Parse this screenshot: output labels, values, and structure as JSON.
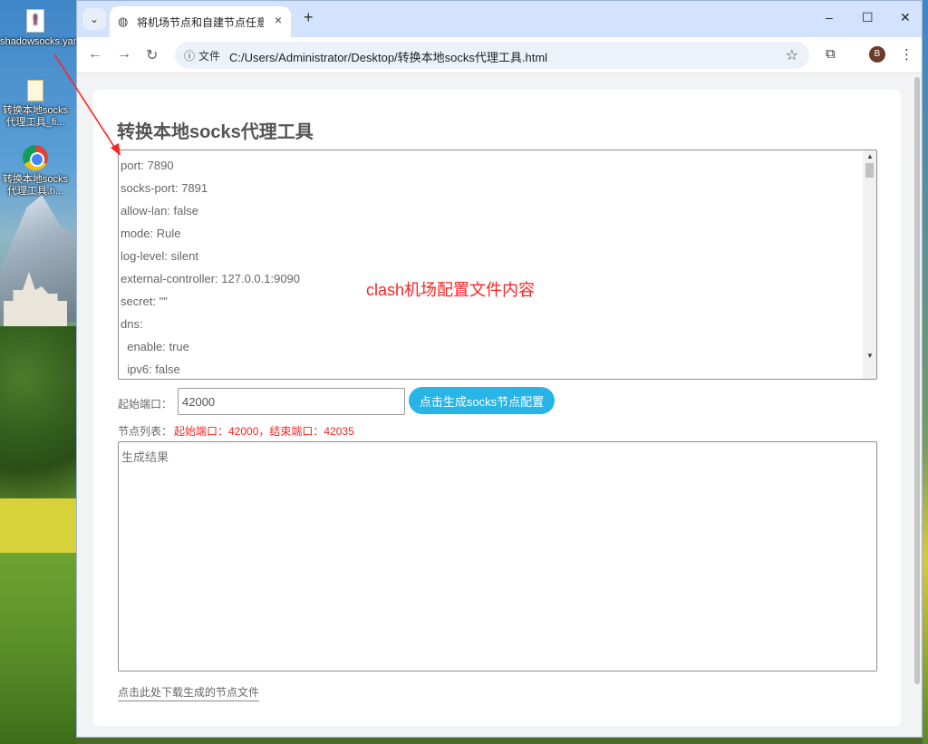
{
  "desktop": {
    "icons": [
      {
        "label": "shadowsocks.yaml",
        "icon": "yaml-file-icon"
      },
      {
        "label": "转换本地socks代理工具_fi...",
        "icon": "file-icon"
      },
      {
        "label": "转换本地socks代理工具.h...",
        "icon": "chrome-icon"
      }
    ]
  },
  "browser": {
    "tab_title": "将机场节点和自建节点任意协议",
    "new_tab": "+",
    "close_tab": "×",
    "window_controls": {
      "minimize": "–",
      "maximize": "☐",
      "close": "✕"
    },
    "omnibox": {
      "scheme_label": "文件",
      "url": "C:/Users/Administrator/Desktop/转换本地socks代理工具.html"
    },
    "avatar_letter": "B"
  },
  "page": {
    "title": "转换本地socks代理工具",
    "config_lines": [
      "port: 7890",
      "socks-port: 7891",
      "allow-lan: false",
      "mode: Rule",
      "log-level: silent",
      "external-controller: 127.0.0.1:9090",
      "secret: \"\"",
      "dns:",
      "  enable: true",
      "  ipv6: false"
    ],
    "annotation": "clash机场配置文件内容",
    "start_port_label": "起始端口：",
    "start_port_value": "42000",
    "generate_button": "点击生成socks节点配置",
    "node_list_label": "节点列表：",
    "node_list_range": "起始端口：42000，结束端口：42035",
    "result_placeholder": "生成结果",
    "download_link": "点击此处下载生成的节点文件"
  },
  "colors": {
    "accent_button": "#29b4e6",
    "annotation_red": "#ff2222",
    "tabbar": "#d3e3fd"
  }
}
